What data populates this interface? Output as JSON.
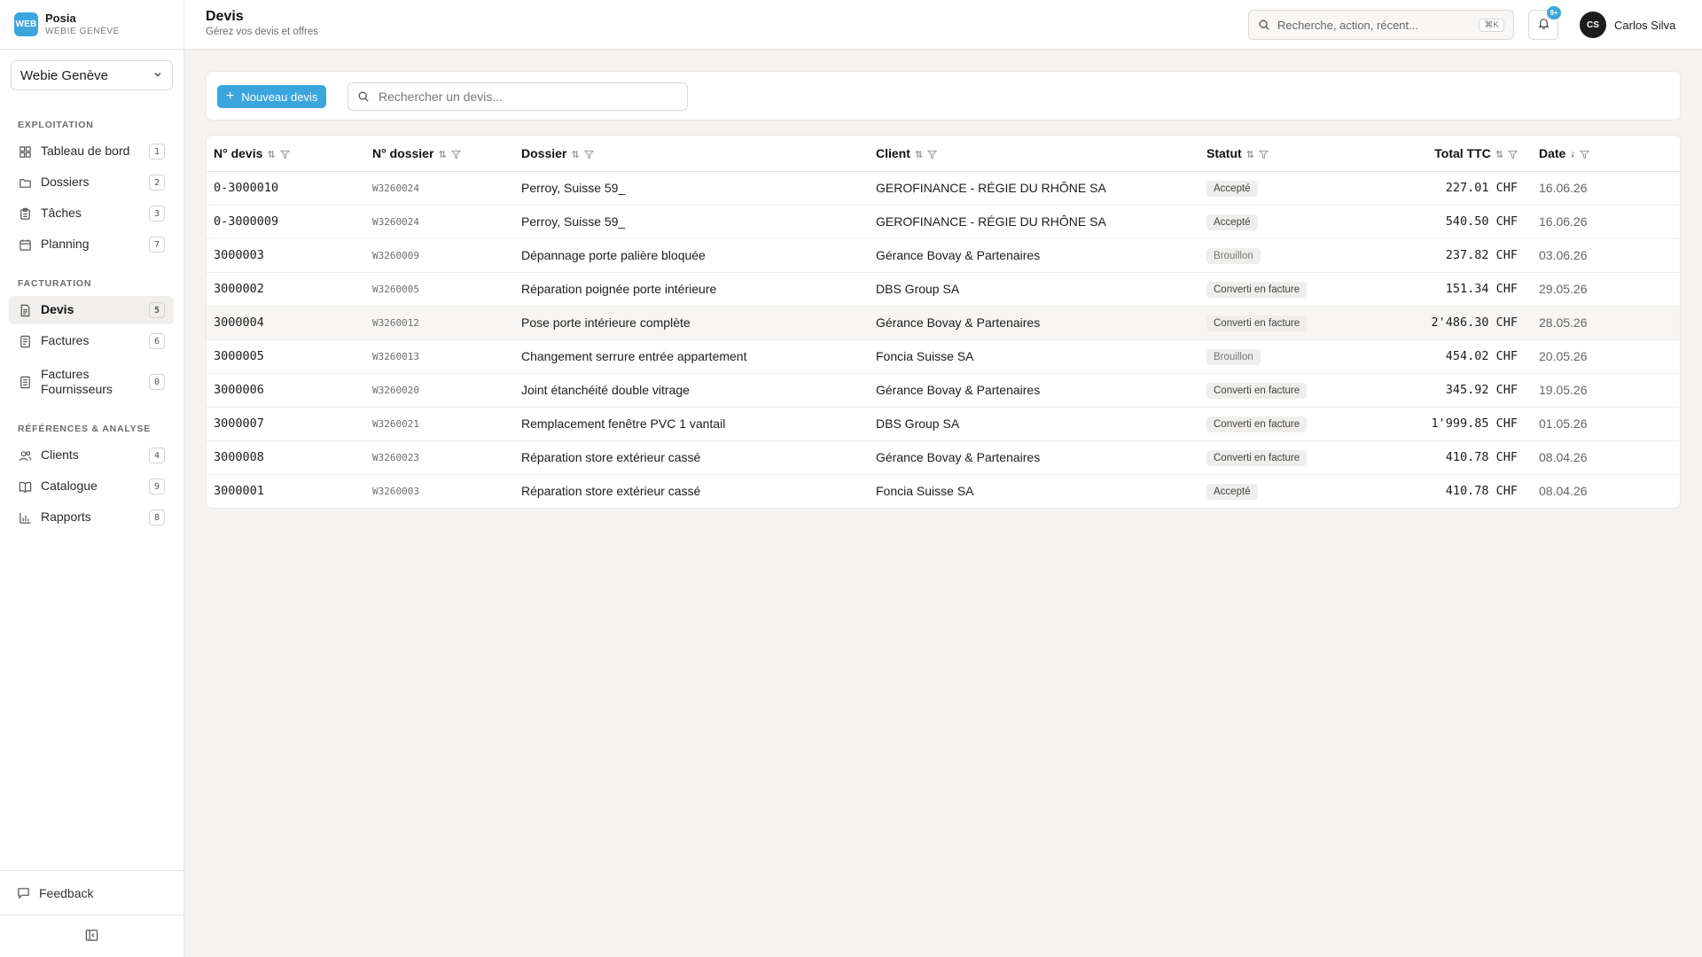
{
  "brand": {
    "logo": "WEB",
    "name": "Posia",
    "subtitle": "WEBIE GENÈVE"
  },
  "org_select": {
    "value": "Webie Genève"
  },
  "sidebar": {
    "sections": [
      {
        "label": "EXPLOITATION"
      },
      {
        "label": "FACTURATION"
      },
      {
        "label": "RÉFÉRENCES & ANALYSE"
      }
    ],
    "items": [
      {
        "label": "Tableau de bord",
        "badge": "1",
        "icon": "dashboard-icon"
      },
      {
        "label": "Dossiers",
        "badge": "2",
        "icon": "folder-icon"
      },
      {
        "label": "Tâches",
        "badge": "3",
        "icon": "clipboard-icon"
      },
      {
        "label": "Planning",
        "badge": "7",
        "icon": "calendar-icon"
      },
      {
        "label": "Devis",
        "badge": "5",
        "icon": "document-icon",
        "active": true
      },
      {
        "label": "Factures",
        "badge": "6",
        "icon": "receipt-icon"
      },
      {
        "label": "Factures Fournisseurs",
        "badge": "0",
        "icon": "supplier-invoice-icon"
      },
      {
        "label": "Clients",
        "badge": "4",
        "icon": "users-icon"
      },
      {
        "label": "Catalogue",
        "badge": "9",
        "icon": "book-icon"
      },
      {
        "label": "Rapports",
        "badge": "8",
        "icon": "bar-chart-icon"
      }
    ],
    "feedback_label": "Feedback"
  },
  "header": {
    "title": "Devis",
    "subtitle": "Gérez vos devis et offres",
    "search_placeholder": "Recherche, action, récent...",
    "search_shortcut": "⌘K",
    "notification_badge": "9+",
    "user_initials": "CS",
    "user_name": "Carlos Silva"
  },
  "toolbar": {
    "new_button_label": "Nouveau devis",
    "search_placeholder": "Rechercher un devis..."
  },
  "table": {
    "columns": [
      "N° devis",
      "N° dossier",
      "Dossier",
      "Client",
      "Statut",
      "Total TTC",
      "Date"
    ],
    "rows": [
      {
        "devis": "0-3000010",
        "dossier_no": "W3260024",
        "dossier": "Perroy, Suisse 59_",
        "client": "GEROFINANCE - RÉGIE DU RHÔNE SA",
        "statut": "Accepté",
        "total": "227.01 CHF",
        "date": "16.06.26"
      },
      {
        "devis": "0-3000009",
        "dossier_no": "W3260024",
        "dossier": "Perroy, Suisse 59_",
        "client": "GEROFINANCE - RÉGIE DU RHÔNE SA",
        "statut": "Accepté",
        "total": "540.50 CHF",
        "date": "16.06.26"
      },
      {
        "devis": "3000003",
        "dossier_no": "W3260009",
        "dossier": "Dépannage porte palière bloquée",
        "client": "Gérance Bovay & Partenaires",
        "statut": "Brouillon",
        "total": "237.82 CHF",
        "date": "03.06.26"
      },
      {
        "devis": "3000002",
        "dossier_no": "W3260005",
        "dossier": "Réparation poignée porte intérieure",
        "client": "DBS Group SA",
        "statut": "Converti en facture",
        "total": "151.34 CHF",
        "date": "29.05.26"
      },
      {
        "devis": "3000004",
        "dossier_no": "W3260012",
        "dossier": "Pose porte intérieure complète",
        "client": "Gérance Bovay & Partenaires",
        "statut": "Converti en facture",
        "total": "2'486.30 CHF",
        "date": "28.05.26"
      },
      {
        "devis": "3000005",
        "dossier_no": "W3260013",
        "dossier": "Changement serrure entrée appartement",
        "client": "Foncia Suisse SA",
        "statut": "Brouillon",
        "total": "454.02 CHF",
        "date": "20.05.26"
      },
      {
        "devis": "3000006",
        "dossier_no": "W3260020",
        "dossier": "Joint étanchéité double vitrage",
        "client": "Gérance Bovay & Partenaires",
        "statut": "Converti en facture",
        "total": "345.92 CHF",
        "date": "19.05.26"
      },
      {
        "devis": "3000007",
        "dossier_no": "W3260021",
        "dossier": "Remplacement fenêtre PVC 1 vantail",
        "client": "DBS Group SA",
        "statut": "Converti en facture",
        "total": "1'999.85 CHF",
        "date": "01.05.26"
      },
      {
        "devis": "3000008",
        "dossier_no": "W3260023",
        "dossier": "Réparation store extérieur cassé",
        "client": "Gérance Bovay & Partenaires",
        "statut": "Converti en facture",
        "total": "410.78 CHF",
        "date": "08.04.26"
      },
      {
        "devis": "3000001",
        "dossier_no": "W3260003",
        "dossier": "Réparation store extérieur cassé",
        "client": "Foncia Suisse SA",
        "statut": "Accepté",
        "total": "410.78 CHF",
        "date": "08.04.26"
      }
    ]
  },
  "colors": {
    "accent": "#3ba5dd",
    "active_bg": "#f0efed",
    "page_bg": "#f4f3f1"
  }
}
